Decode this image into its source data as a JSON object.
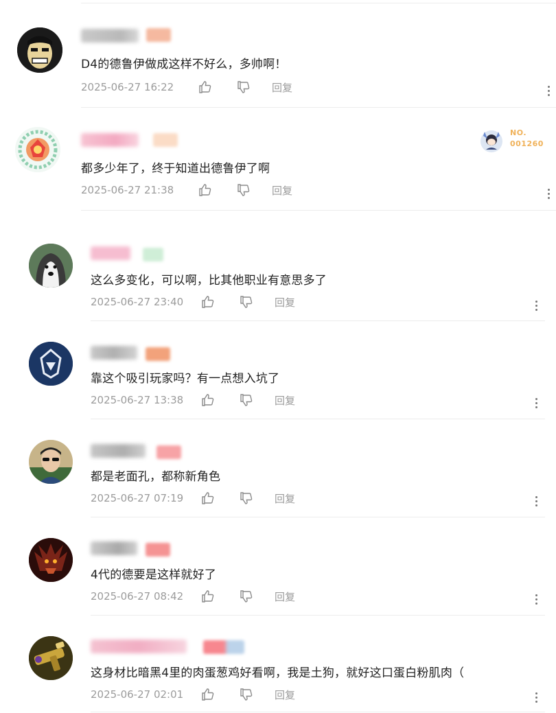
{
  "comments": [
    {
      "text": "D4的德鲁伊做成这样不好么，多帅啊！",
      "time": "2025-06-27 16:22",
      "reply": "回复"
    },
    {
      "text": "都多少年了，终于知道出德鲁伊了啊",
      "time": "2025-06-27 21:38",
      "reply": "回复",
      "fan_badge": {
        "line1": "NO.",
        "line2": "001260"
      }
    },
    {
      "text": "这么多变化，可以啊，比其他职业有意思多了",
      "time": "2025-06-27 23:40",
      "reply": "回复"
    },
    {
      "text": "靠这个吸引玩家吗？有一点想入坑了",
      "time": "2025-06-27 13:38",
      "reply": "回复"
    },
    {
      "text": "都是老面孔，都称新角色",
      "time": "2025-06-27 07:19",
      "reply": "回复"
    },
    {
      "text": "4代的德要是这样就好了",
      "time": "2025-06-27 08:42",
      "reply": "回复"
    },
    {
      "text": "这身材比暗黑4里的肉蛋葱鸡好看啊，我是土狗，就好这口蛋白粉肌肉（",
      "time": "2025-06-27 02:01",
      "reply": "回复"
    }
  ],
  "colors": {
    "text": "#222222",
    "meta": "#9b9b9b",
    "divider": "#ececec",
    "fan_badge": "#f0b25a"
  },
  "icons": [
    "thumbs-up-icon",
    "thumbs-down-icon",
    "more-vertical-icon"
  ]
}
